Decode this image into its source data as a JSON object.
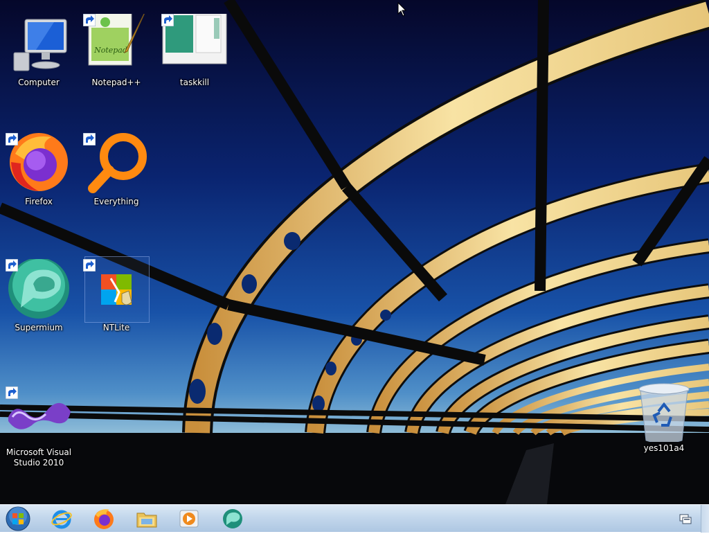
{
  "desktop": {
    "icons": [
      {
        "id": "computer",
        "label": "Computer"
      },
      {
        "id": "notepadpp",
        "label": "Notepad++"
      },
      {
        "id": "taskkill",
        "label": "taskkill"
      },
      {
        "id": "firefox",
        "label": "Firefox"
      },
      {
        "id": "everything",
        "label": "Everything"
      },
      {
        "id": "supermium",
        "label": "Supermium"
      },
      {
        "id": "ntlite",
        "label": "NTLite"
      },
      {
        "id": "vs2010",
        "label": "Microsoft Visual Studio 2010"
      },
      {
        "id": "recycle",
        "label": "yes101a4"
      }
    ],
    "selected_icon": "NTLite"
  },
  "taskbar": {
    "start": "windows-orb-icon",
    "pinned": [
      "internet-explorer-icon",
      "firefox-icon",
      "file-explorer-icon",
      "media-player-icon",
      "supermium-icon"
    ],
    "tray": [
      "action-center-icon"
    ]
  },
  "colors": {
    "sky_top": "#05082c",
    "sky_mid": "#0c2f86",
    "horizon": "#6aa8cf",
    "bridge": "#f3d890",
    "taskbar": "#c3d7ec"
  }
}
